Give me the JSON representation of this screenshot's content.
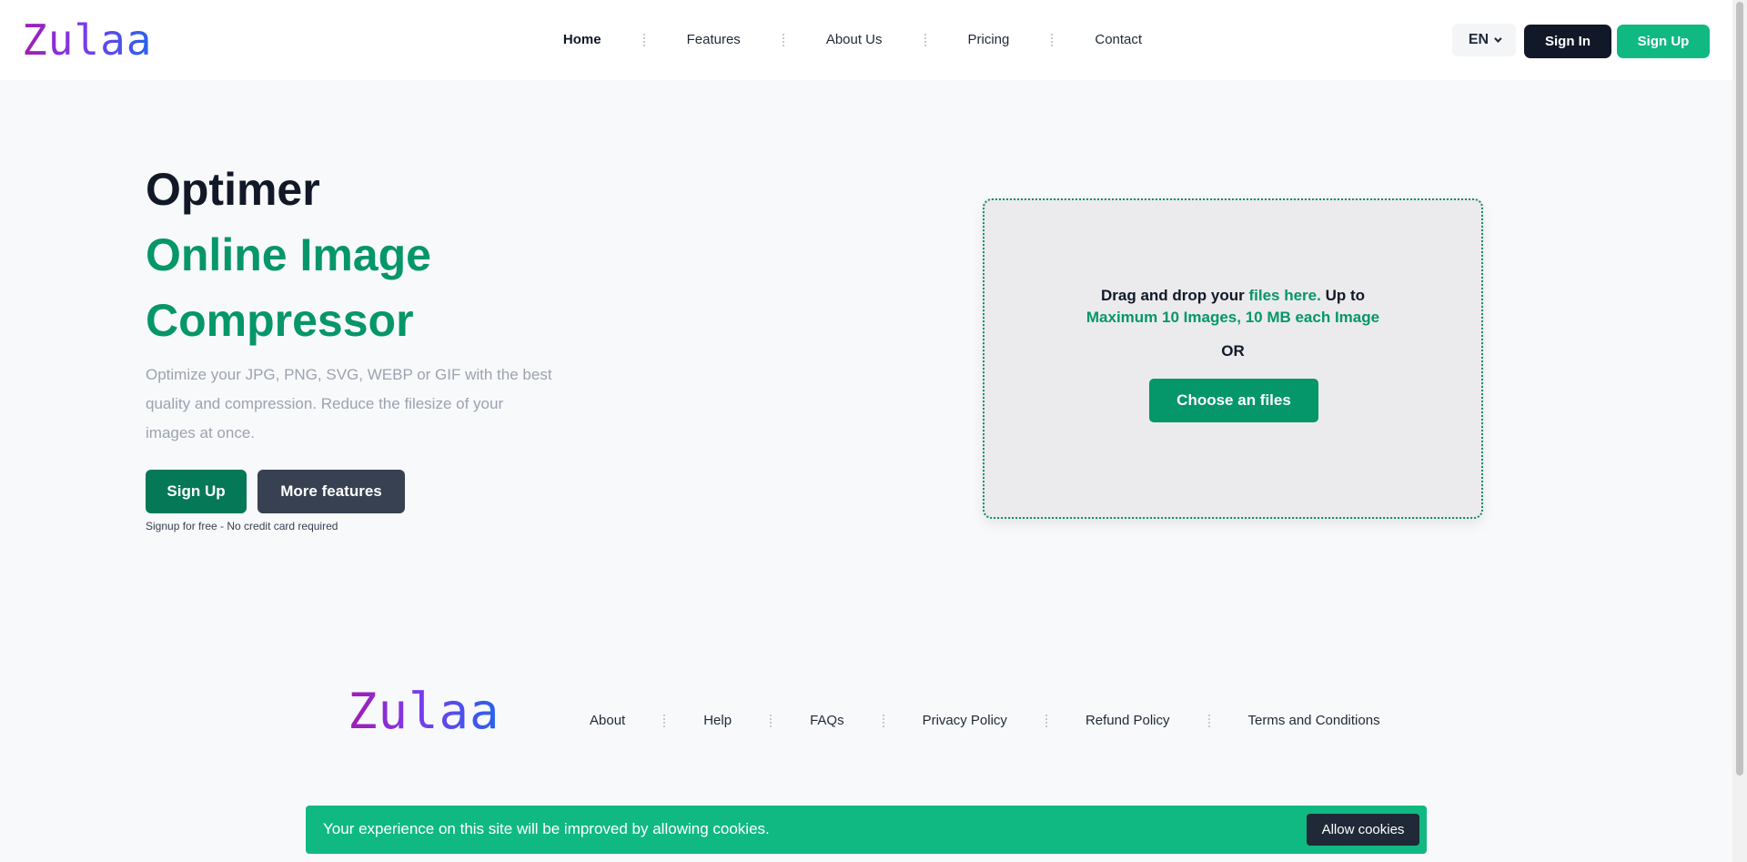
{
  "header": {
    "logo": "Zulaa",
    "nav": [
      "Home",
      "Features",
      "About Us",
      "Pricing",
      "Contact"
    ],
    "active_nav": "Home",
    "lang": "EN",
    "signin_label": "Sign In",
    "signup_label": "Sign Up"
  },
  "hero": {
    "title": "Optimer",
    "subtitle": "Online Image Compressor",
    "description": "Optimize your JPG, PNG, SVG, WEBP or GIF with the best quality and compression. Reduce the filesize of your images at once.",
    "signup_label": "Sign Up",
    "more_label": "More features",
    "note": "Signup for free - No credit card required"
  },
  "dropzone": {
    "text_before": "Drag and drop your ",
    "text_link": "files here.",
    "text_after": " Up to",
    "limits": "Maximum 10 Images, 10 MB each Image",
    "or_label": "OR",
    "choose_label": "Choose an files"
  },
  "footer": {
    "logo": "Zulaa",
    "links": [
      "About",
      "Help",
      "FAQs",
      "Privacy Policy",
      "Refund Policy",
      "Terms and Conditions"
    ]
  },
  "cookie": {
    "message": "Your experience on this site will be improved by allowing cookies.",
    "allow_label": "Allow cookies"
  },
  "colors": {
    "accent_green": "#10b981",
    "dark_green": "#047857",
    "hero_green": "#059669",
    "dark": "#111827"
  }
}
